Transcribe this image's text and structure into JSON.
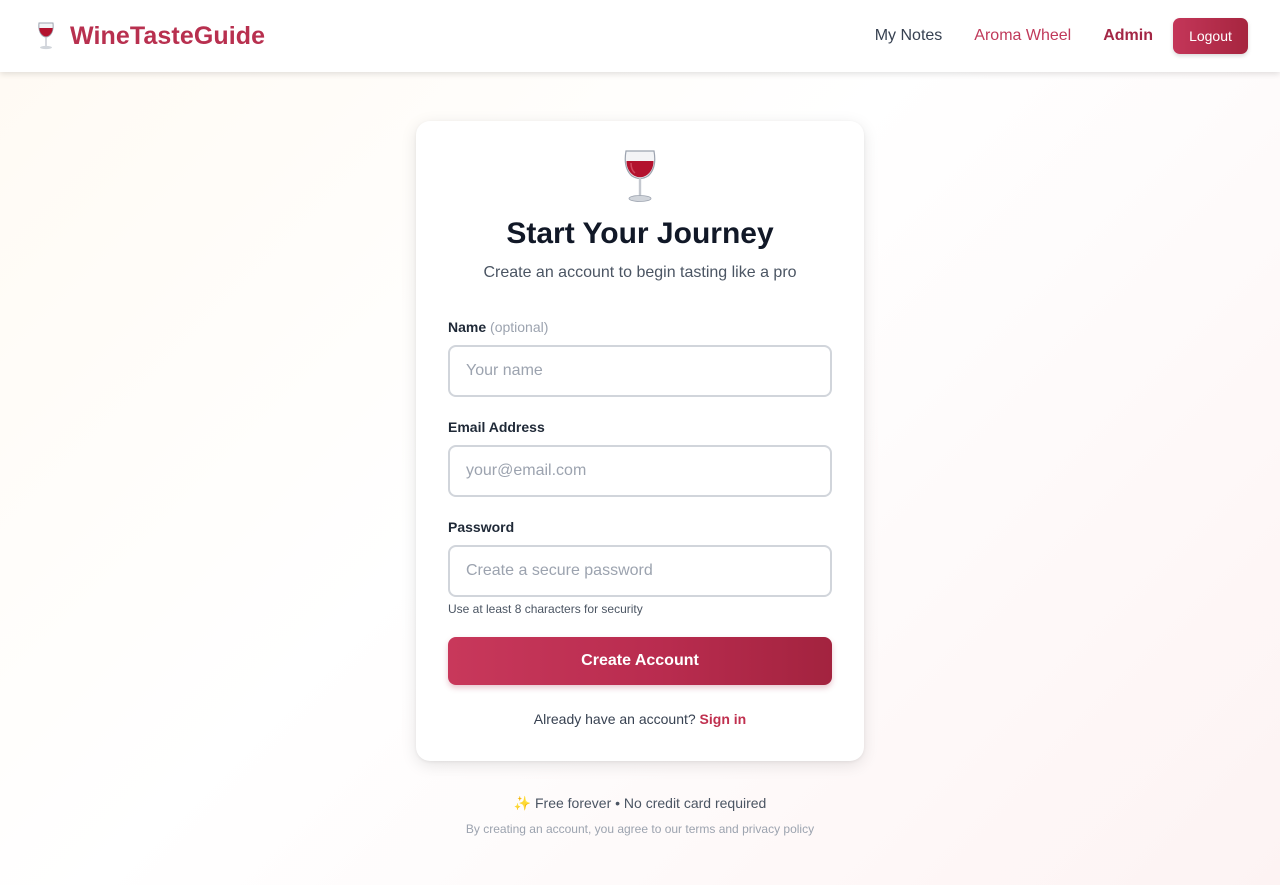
{
  "header": {
    "brand_name": "WineTasteGuide",
    "brand_icon": "wine-glass-icon",
    "nav": {
      "my_notes": "My Notes",
      "aroma_wheel": "Aroma Wheel",
      "admin": "Admin",
      "logout": "Logout"
    }
  },
  "card": {
    "icon": "wine-glass-icon",
    "title": "Start Your Journey",
    "subtitle": "Create an account to begin tasting like a pro",
    "fields": {
      "name": {
        "label": "Name",
        "optional": "(optional)",
        "placeholder": "Your name",
        "value": ""
      },
      "email": {
        "label": "Email Address",
        "placeholder": "your@email.com",
        "value": ""
      },
      "password": {
        "label": "Password",
        "placeholder": "Create a secure password",
        "value": "",
        "hint": "Use at least 8 characters for security"
      }
    },
    "submit_label": "Create Account",
    "signin_prompt": "Already have an account?",
    "signin_link": "Sign in"
  },
  "footer": {
    "free": "✨ Free forever • No credit card required",
    "terms": "By creating an account, you agree to our terms and privacy policy"
  },
  "colors": {
    "brand": "#b8304f",
    "accent": "#c0395a",
    "button_start": "#c8385b",
    "button_end": "#a3233f"
  }
}
